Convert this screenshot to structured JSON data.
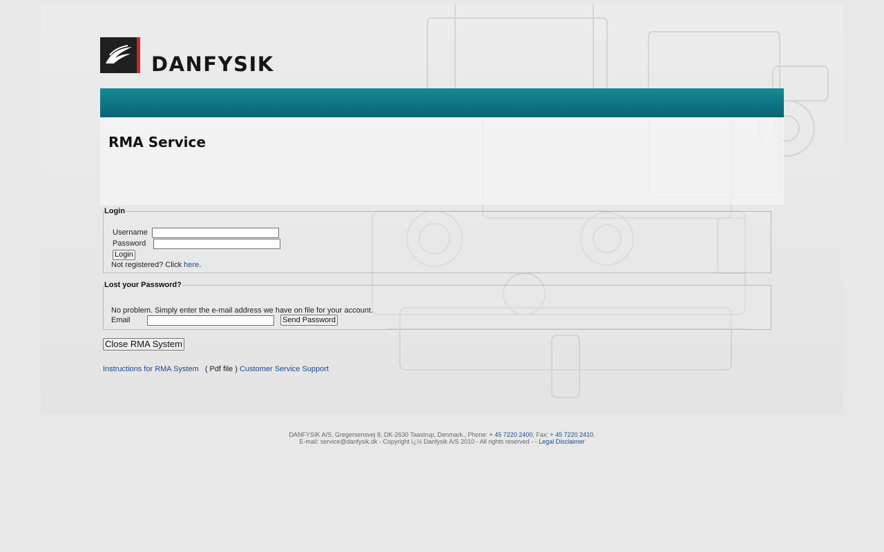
{
  "brand": {
    "name": "DANFYSIK"
  },
  "header": {
    "title": "RMA Service"
  },
  "login": {
    "legend": "Login",
    "username_label": "Username",
    "password_label": "Password",
    "submit_label": "Login",
    "register_prefix": "Not registered? Click",
    "register_link": "here",
    "register_suffix": "."
  },
  "lost_password": {
    "legend": "Lost your Password?",
    "description": "No problem. Simply enter the e-mail address we have on file for your account.",
    "email_label": "Email",
    "submit_label": "Send Password"
  },
  "actions": {
    "close_label": "Close RMA System"
  },
  "links": {
    "instructions": "Instructions for RMA System",
    "pdf_note": "( Pdf file )",
    "support": "Customer Service Support"
  },
  "footer": {
    "line1_prefix": "DANFYSIK A/S, Gregersensvej 8, DK-2630 Taastrup, Denmark., Phone: ",
    "phone": "+ 45 7220 2400",
    "line1_mid": ", Fax: ",
    "fax": "+ 45 7220 2410",
    "line1_suffix": ".",
    "line2_prefix": "E-mail: service@danfysik.dk - Copyright ï¿½ Danfysik A/S 2010 - All rights reserved - - ",
    "disclaimer": "Legal Disclaimer"
  }
}
